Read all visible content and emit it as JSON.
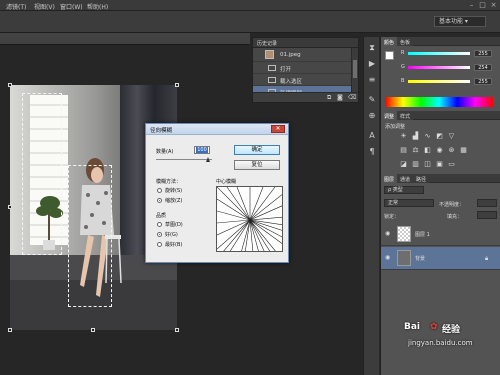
{
  "menubar": {
    "items": [
      "滤镜(T)",
      "视图(V)",
      "窗口(W)",
      "帮助(H)"
    ]
  },
  "workspace": {
    "label": "基本功能"
  },
  "history": {
    "tab_label": "历史记录",
    "snapshot_label": "01.jpeg",
    "items": [
      "打开",
      "载入选区",
      "新建图层"
    ],
    "selected_index": 2
  },
  "color_panel": {
    "tabs": [
      "颜色",
      "色板"
    ],
    "channels": [
      {
        "label": "R",
        "value": "255"
      },
      {
        "label": "G",
        "value": "254"
      },
      {
        "label": "B",
        "value": "255"
      }
    ]
  },
  "adjust_panel": {
    "tabs": [
      "调整",
      "样式"
    ],
    "title": "添加调整"
  },
  "layers_panel": {
    "tabs": [
      "图层",
      "通道",
      "路径"
    ],
    "filter_label": "ρ 类型",
    "blend_label": "正常",
    "opacity_label": "不透明度：",
    "lock_label": "锁定：",
    "fill_label": "填充：",
    "layers": [
      {
        "name": "图层 1",
        "visible": true
      },
      {
        "name": "背景",
        "visible": true,
        "selected": true
      }
    ]
  },
  "dialog": {
    "title": "径向模糊",
    "amount_label": "数量(A)",
    "amount_value": "100",
    "ok_label": "确定",
    "reset_label": "复位",
    "method_label": "模糊方法：",
    "methods": [
      {
        "label": "旋转(S)",
        "checked": false
      },
      {
        "label": "缩放(Z)",
        "checked": true
      }
    ],
    "quality_label": "品质",
    "qualities": [
      {
        "label": "草图(D)",
        "checked": false
      },
      {
        "label": "好(G)",
        "checked": true
      },
      {
        "label": "最好(B)",
        "checked": false
      }
    ],
    "center_label": "中心模糊"
  },
  "watermark": {
    "brand": "Bai",
    "brand2": "经验",
    "url": "jingyan.baidu.com"
  },
  "colors": {
    "accent_blue": "#5b7497",
    "dialog_border": "#6e8bb5"
  }
}
